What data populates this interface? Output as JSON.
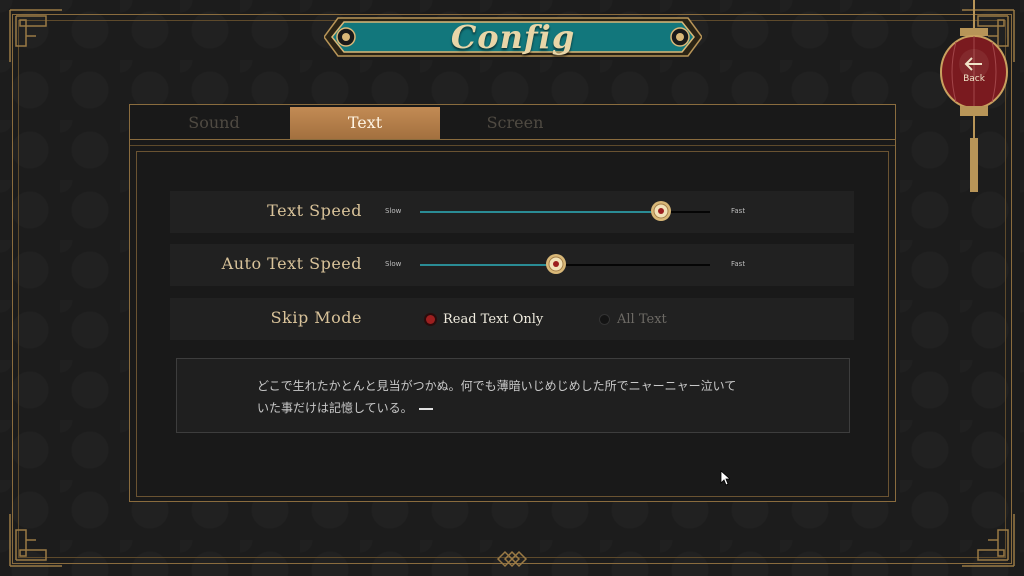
{
  "title": "Config",
  "back_button": {
    "label": "Back"
  },
  "tabs": [
    {
      "label": "Sound",
      "active": false
    },
    {
      "label": "Text",
      "active": true
    },
    {
      "label": "Screen",
      "active": false
    }
  ],
  "settings": {
    "text_speed": {
      "label": "Text Speed",
      "min_label": "Slow",
      "max_label": "Fast",
      "value_fraction": 0.83
    },
    "auto_text_speed": {
      "label": "Auto Text Speed",
      "min_label": "Slow",
      "max_label": "Fast",
      "value_fraction": 0.47
    },
    "skip_mode": {
      "label": "Skip Mode",
      "options": [
        {
          "label": "Read Text Only",
          "selected": true
        },
        {
          "label": "All Text",
          "selected": false
        }
      ]
    }
  },
  "preview": {
    "line1": "どこで生れたかとんと見当がつかぬ。何でも薄暗いじめじめした所でニャーニャー泣いて",
    "line2": "いた事だけは記憶している。"
  },
  "colors": {
    "accent_teal": "#2a8c95",
    "tab_active": "#b37c48",
    "gold": "#8a6c3e",
    "radio_selected": "#9c1f1f",
    "lantern_red": "#7a1a1f"
  }
}
